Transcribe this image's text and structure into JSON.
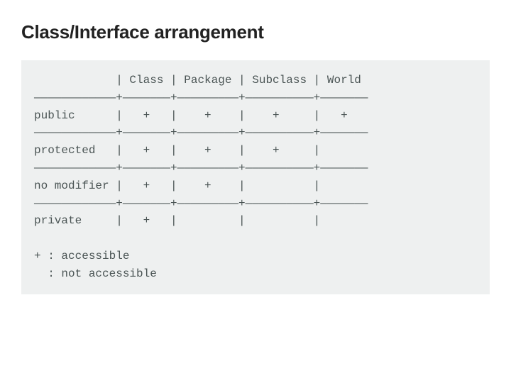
{
  "title": "Class/Interface arrangement",
  "chart_data": {
    "type": "table",
    "columns": [
      "",
      "Class",
      "Package",
      "Subclass",
      "World"
    ],
    "rows": [
      {
        "modifier": "public",
        "Class": "+",
        "Package": "+",
        "Subclass": "+",
        "World": "+"
      },
      {
        "modifier": "protected",
        "Class": "+",
        "Package": "+",
        "Subclass": "+",
        "World": ""
      },
      {
        "modifier": "no modifier",
        "Class": "+",
        "Package": "+",
        "Subclass": "",
        "World": ""
      },
      {
        "modifier": "private",
        "Class": "+",
        "Package": "",
        "Subclass": "",
        "World": ""
      }
    ],
    "legend": [
      {
        "symbol": "+",
        "meaning": "accessible"
      },
      {
        "symbol": " ",
        "meaning": "not accessible"
      }
    ]
  },
  "ascii": {
    "line_header": "            | Class | Package | Subclass | World",
    "line_sep": "————————————+———————+—————————+——————————+———————",
    "line_public": "public      |   +   |    +    |    +     |   +",
    "line_prot": "protected   |   +   |    +    |    +     |",
    "line_nomod": "no modifier |   +   |    +    |          |",
    "line_priv": "private     |   +   |         |          |",
    "legend1": "+ : accessible",
    "legend2": "  : not accessible"
  }
}
